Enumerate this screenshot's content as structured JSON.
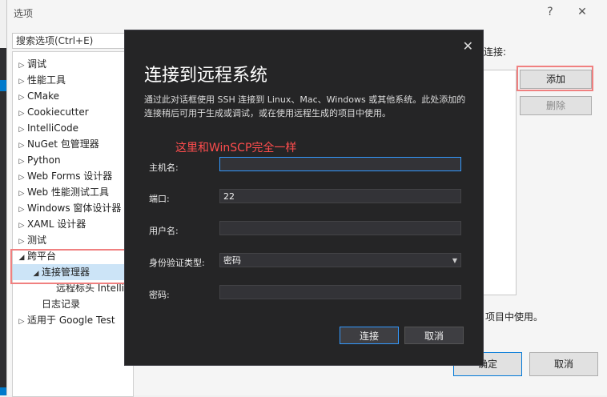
{
  "options_dialog": {
    "title": "选项",
    "help_glyph": "?",
    "close_glyph": "✕",
    "search_placeholder": "搜索选项(Ctrl+E)",
    "tree": [
      {
        "label": "调试",
        "arrow": "▷",
        "indent": 0
      },
      {
        "label": "性能工具",
        "arrow": "▷",
        "indent": 0
      },
      {
        "label": "CMake",
        "arrow": "▷",
        "indent": 0
      },
      {
        "label": "Cookiecutter",
        "arrow": "▷",
        "indent": 0
      },
      {
        "label": "IntelliCode",
        "arrow": "▷",
        "indent": 0
      },
      {
        "label": "NuGet 包管理器",
        "arrow": "▷",
        "indent": 0
      },
      {
        "label": "Python",
        "arrow": "▷",
        "indent": 0
      },
      {
        "label": "Web Forms 设计器",
        "arrow": "▷",
        "indent": 0
      },
      {
        "label": "Web 性能测试工具",
        "arrow": "▷",
        "indent": 0
      },
      {
        "label": "Windows 窗体设计器",
        "arrow": "▷",
        "indent": 0
      },
      {
        "label": "XAML 设计器",
        "arrow": "▷",
        "indent": 0
      },
      {
        "label": "测试",
        "arrow": "▷",
        "indent": 0
      },
      {
        "label": "跨平台",
        "arrow": "◢",
        "indent": 0
      },
      {
        "label": "连接管理器",
        "arrow": "◢",
        "indent": 1
      },
      {
        "label": "远程标头 IntelliSense",
        "arrow": "",
        "indent": 2
      },
      {
        "label": "日志记录",
        "arrow": "",
        "indent": 1
      },
      {
        "label": "适用于 Google Test",
        "arrow": "▷",
        "indent": 0
      }
    ],
    "right_label": "连接:",
    "add_label": "添加",
    "remove_label": "删除",
    "note_text": "项目中使用。",
    "ok_label": "确定",
    "cancel_label": "取消"
  },
  "modal": {
    "title": "连接到远程系统",
    "close_glyph": "✕",
    "description": "通过此对话框使用 SSH 连接到 Linux、Mac、Windows 或其他系统。此处添加的连接稍后可用于生成或调试，或在使用远程生成的项目中使用。",
    "annotation": "这里和WinSCP完全一样",
    "fields": {
      "host_label": "主机名:",
      "host_value": "",
      "port_label": "端口:",
      "port_value": "22",
      "user_label": "用户名:",
      "user_value": "",
      "auth_label": "身份验证类型:",
      "auth_value": "密码",
      "password_label": "密码:",
      "password_value": ""
    },
    "connect_label": "连接",
    "cancel_label": "取消"
  },
  "colors": {
    "accent": "#007acc",
    "annotation_red": "#ff4d4d",
    "highlight_box": "#f08080",
    "modal_bg": "#252526"
  }
}
